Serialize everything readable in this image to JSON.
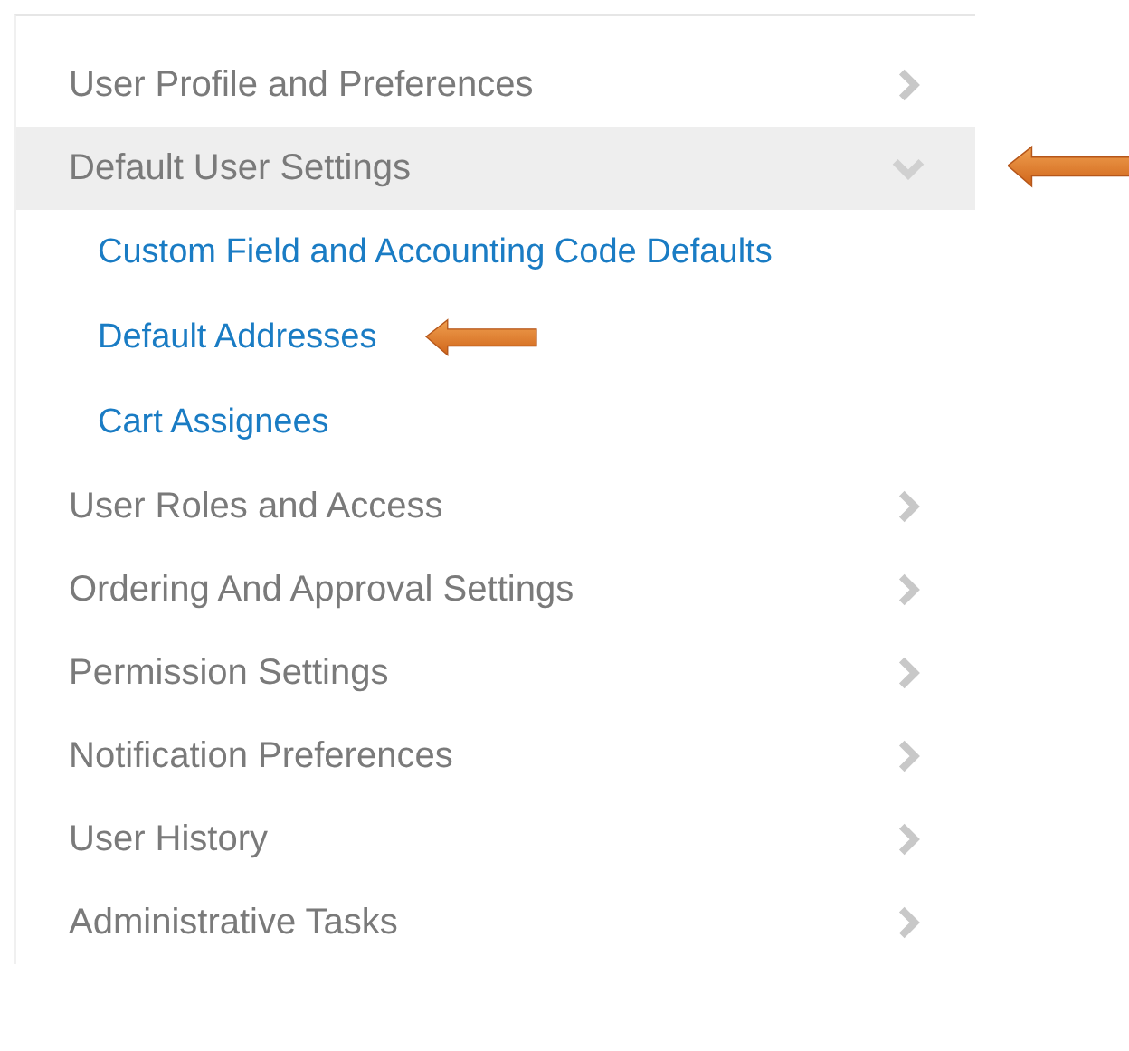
{
  "menu": [
    {
      "label": "User Profile and Preferences",
      "expanded": false,
      "selected": false,
      "callout": false
    },
    {
      "label": "Default User Settings",
      "expanded": true,
      "selected": true,
      "callout": true,
      "children": [
        {
          "label": "Custom Field and Accounting Code Defaults",
          "callout": false
        },
        {
          "label": "Default Addresses",
          "callout": true
        },
        {
          "label": "Cart Assignees",
          "callout": false
        }
      ]
    },
    {
      "label": "User Roles and Access",
      "expanded": false,
      "selected": false,
      "callout": false
    },
    {
      "label": "Ordering And Approval Settings",
      "expanded": false,
      "selected": false,
      "callout": false
    },
    {
      "label": "Permission Settings",
      "expanded": false,
      "selected": false,
      "callout": false
    },
    {
      "label": "Notification Preferences",
      "expanded": false,
      "selected": false,
      "callout": false
    },
    {
      "label": "User History",
      "expanded": false,
      "selected": false,
      "callout": false
    },
    {
      "label": "Administrative Tasks",
      "expanded": false,
      "selected": false,
      "callout": false
    }
  ]
}
